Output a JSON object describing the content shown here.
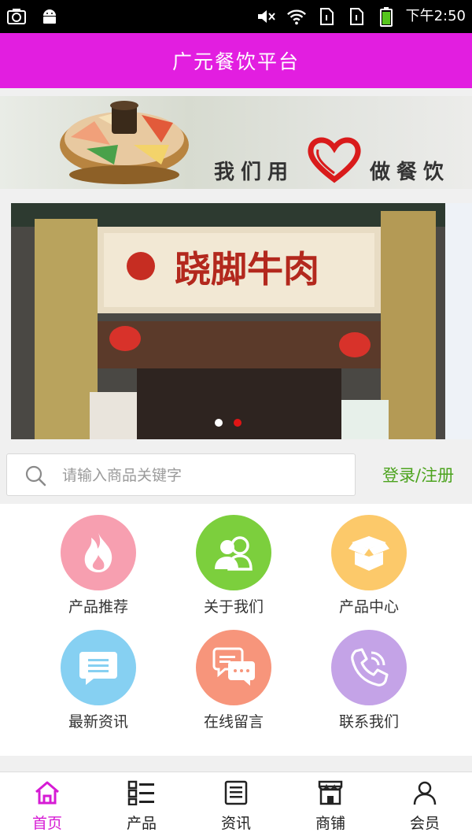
{
  "status_bar": {
    "time": "下午2:50",
    "icons": [
      "screenshot-icon",
      "android-icon",
      "mute-icon",
      "wifi-icon",
      "sim-icon",
      "sim-icon",
      "battery-icon"
    ]
  },
  "header": {
    "title": "广元餐饮平台",
    "background": "#e21ee0"
  },
  "slogan_banner": {
    "text_left": "我们用",
    "text_right": "做餐饮",
    "icon": "heart-icon"
  },
  "carousel": {
    "sign_text": "跷脚牛肉",
    "slide_count": 2,
    "active_index": 1
  },
  "search": {
    "placeholder": "请输入商品关键字",
    "icon": "search-icon"
  },
  "account": {
    "login_label": "登录/注册",
    "color": "#4ca31e"
  },
  "grid": [
    {
      "label": "产品推荐",
      "icon": "fire-icon",
      "color": "#f79fb0"
    },
    {
      "label": "关于我们",
      "icon": "users-icon",
      "color": "#7ccf3d"
    },
    {
      "label": "产品中心",
      "icon": "box-icon",
      "color": "#fcc96a"
    },
    {
      "label": "最新资讯",
      "icon": "message-icon",
      "color": "#86d0f2"
    },
    {
      "label": "在线留言",
      "icon": "chat-icon",
      "color": "#f7957b"
    },
    {
      "label": "联系我们",
      "icon": "phone-icon",
      "color": "#c4a3e7"
    }
  ],
  "bottom_nav": [
    {
      "label": "首页",
      "icon": "home-icon",
      "active": true
    },
    {
      "label": "产品",
      "icon": "grid-list-icon",
      "active": false
    },
    {
      "label": "资讯",
      "icon": "news-icon",
      "active": false
    },
    {
      "label": "商铺",
      "icon": "shop-icon",
      "active": false
    },
    {
      "label": "会员",
      "icon": "user-icon",
      "active": false
    }
  ],
  "accent_color": "#d61bd4"
}
